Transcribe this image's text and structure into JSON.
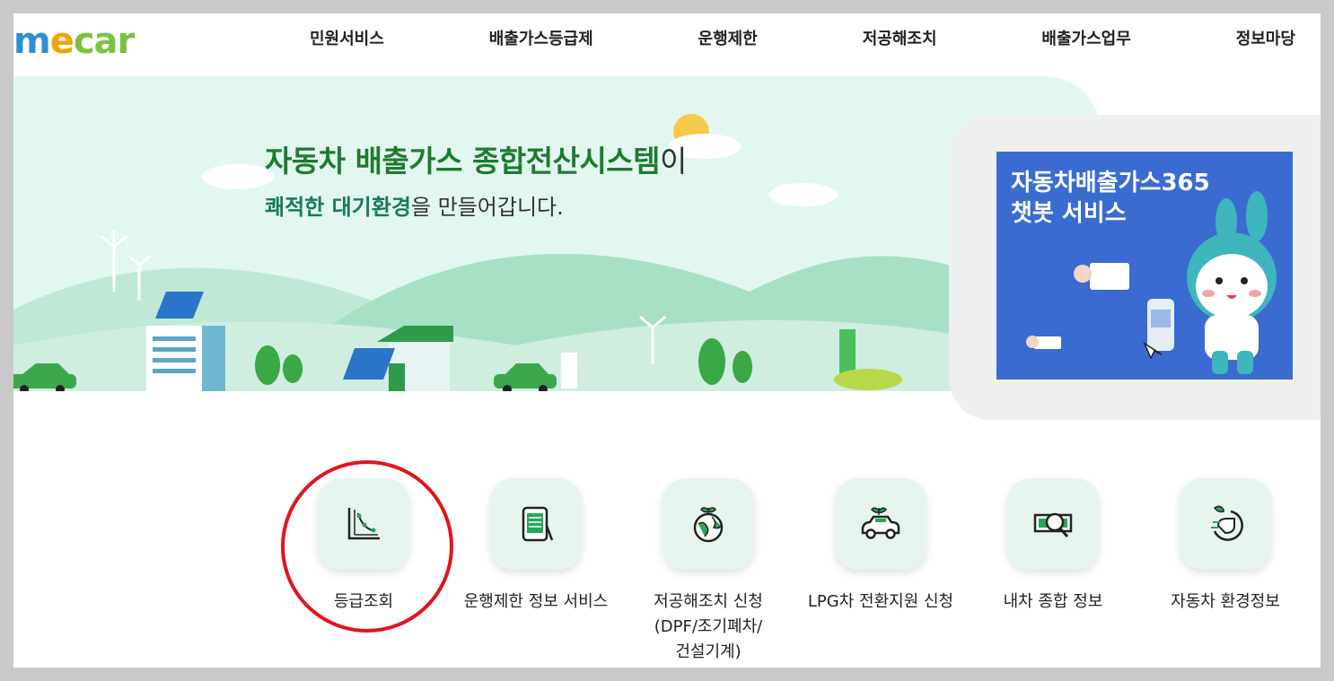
{
  "logo": {
    "text_m": "m",
    "text_e": "e",
    "text_car": "car"
  },
  "nav": [
    "민원서비스",
    "배출가스등급제",
    "운행제한",
    "저공해조치",
    "배출가스업무",
    "정보마당"
  ],
  "hero": {
    "title_strong": "자동차 배출가스 종합전산시스템",
    "title_tail": "이",
    "sub_strong": "쾌적한 대기환경",
    "sub_tail": "을 만들어갑니다."
  },
  "banner": {
    "line1": "자동차배출가스365",
    "line2": "챗봇 서비스"
  },
  "quick_menu": [
    {
      "label": "등급조회",
      "icon": "grade-chart-icon"
    },
    {
      "label": "운행제한 정보 서비스",
      "icon": "tablet-icon"
    },
    {
      "label": "저공해조치 신청\n(DPF/조기폐차/\n건설기계)",
      "icon": "earth-sprout-icon"
    },
    {
      "label": "LPG차 전환지원 신청",
      "icon": "eco-car-icon"
    },
    {
      "label": "내차 종합 정보",
      "icon": "magnifier-money-icon"
    },
    {
      "label": "자동차 환경정보",
      "icon": "eco-leaf-icon"
    }
  ],
  "colors": {
    "hero_bg": "#e3f7f1",
    "banner_bg": "#3a6bd1",
    "highlight_circle": "#e2141b",
    "brand_green": "#1e7b2e"
  }
}
